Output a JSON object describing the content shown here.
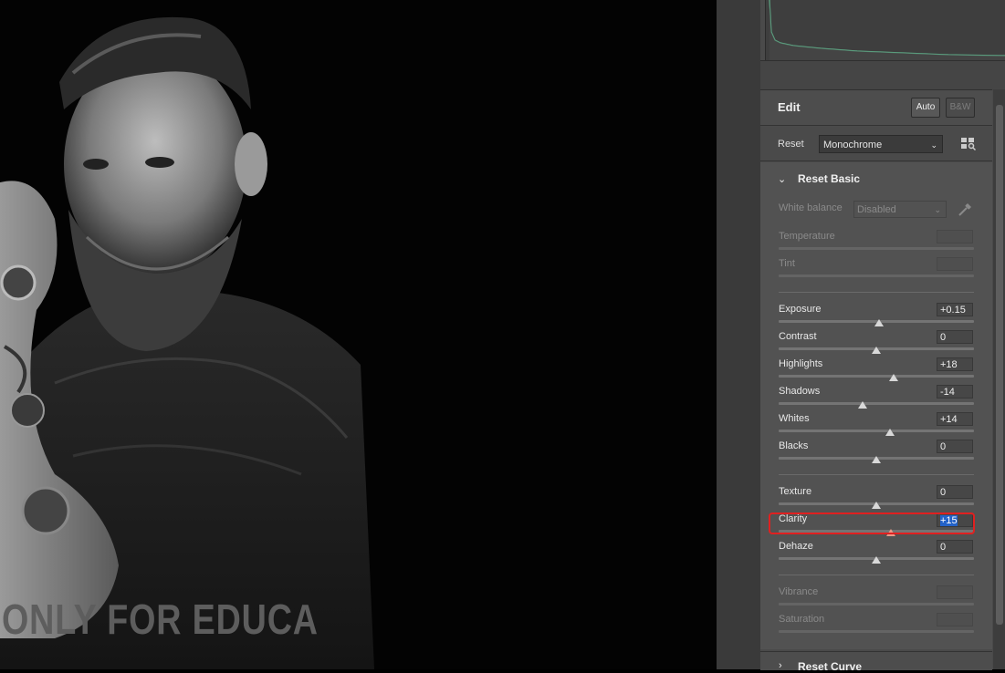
{
  "watermark": "ONLY FOR EDUCA",
  "edit": {
    "title": "Edit",
    "auto_label": "Auto",
    "bw_label": "B&W"
  },
  "profile": {
    "reset_label": "Reset",
    "selected": "Monochrome"
  },
  "basic": {
    "header": "Reset Basic",
    "white_balance": {
      "label": "White balance",
      "value": "Disabled"
    },
    "temperature": {
      "label": "Temperature"
    },
    "tint": {
      "label": "Tint"
    },
    "exposure": {
      "label": "Exposure",
      "value": "+0.15"
    },
    "contrast": {
      "label": "Contrast",
      "value": "0"
    },
    "highlights": {
      "label": "Highlights",
      "value": "+18"
    },
    "shadows": {
      "label": "Shadows",
      "value": "-14"
    },
    "whites": {
      "label": "Whites",
      "value": "+14"
    },
    "blacks": {
      "label": "Blacks",
      "value": "0"
    },
    "texture": {
      "label": "Texture",
      "value": "0"
    },
    "clarity": {
      "label": "Clarity",
      "value": "+15"
    },
    "dehaze": {
      "label": "Dehaze",
      "value": "0"
    },
    "vibrance": {
      "label": "Vibrance"
    },
    "saturation": {
      "label": "Saturation"
    }
  },
  "curve": {
    "header": "Reset Curve"
  },
  "colors": {
    "histogram_line": "#5fb08a",
    "highlight": "#e02020",
    "selection": "#2362c8"
  }
}
